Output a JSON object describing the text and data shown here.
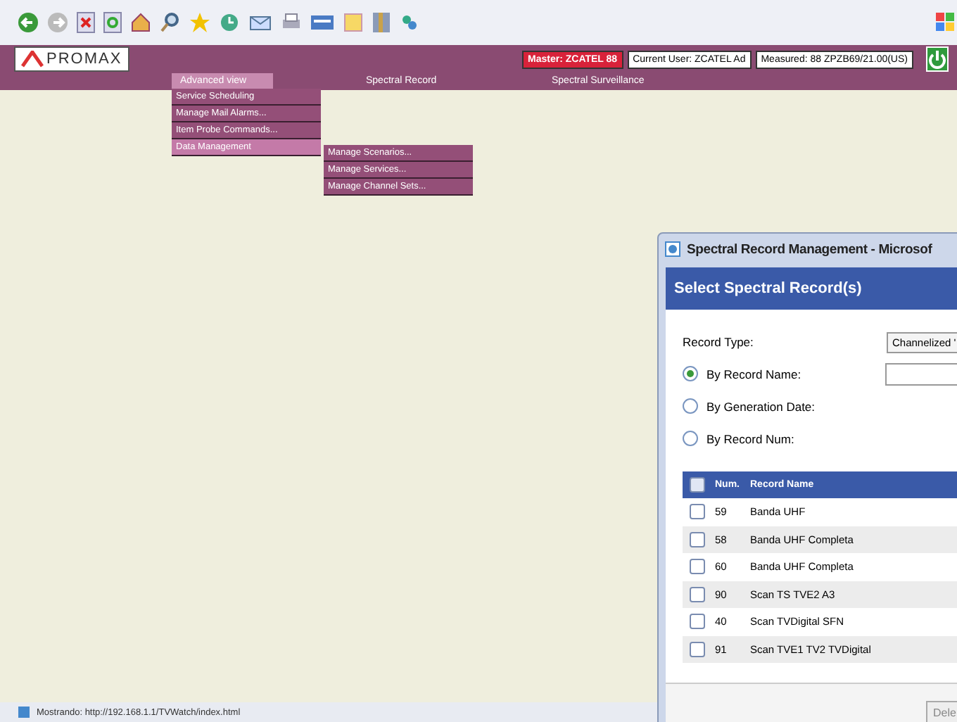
{
  "header": {
    "logo": "PROMAX",
    "badges": [
      {
        "kind": "alert",
        "text": "Master: ZCATEL 88"
      },
      {
        "kind": "field",
        "text": "Current User: ZCATEL Ad"
      },
      {
        "kind": "field",
        "text": "Measured: 88 ZPZB69/21.00(US)"
      }
    ]
  },
  "menu": [
    {
      "label": "Advanced view",
      "selected": true
    },
    {
      "label": "Spectral Record",
      "selected": false
    },
    {
      "label": "Spectral Surveillance",
      "selected": false
    }
  ],
  "dropdown": [
    {
      "label": "Service Scheduling",
      "selected": false
    },
    {
      "label": "Manage Mail Alarms...",
      "selected": false
    },
    {
      "label": "Item Probe Commands...",
      "selected": false
    },
    {
      "label": "Data Management",
      "selected": true
    }
  ],
  "submenu": [
    {
      "label": "Manage Scenarios..."
    },
    {
      "label": "Manage Services..."
    },
    {
      "label": "Manage Channel Sets..."
    }
  ],
  "status_bar": "Mostrando: http://192.168.1.1/TVWatch/index.html",
  "dialog": {
    "title": "Spectral Record Management - Microsof",
    "heading": "Select Spectral Record(s)",
    "record_type_label": "Record Type:",
    "record_type_value": "Channelized '",
    "options": [
      {
        "label": "By Record Name:",
        "selected": true
      },
      {
        "label": "By Generation Date:",
        "selected": false
      },
      {
        "label": "By Record Num:",
        "selected": false
      }
    ],
    "table": {
      "all_checked": false,
      "columns": [
        "Num.",
        "Record Name"
      ],
      "rows": [
        {
          "num": "59",
          "name": "Banda UHF",
          "checked": false
        },
        {
          "num": "58",
          "name": "Banda UHF Completa",
          "checked": false
        },
        {
          "num": "60",
          "name": "Banda UHF Completa",
          "checked": false
        },
        {
          "num": "90",
          "name": "Scan TS TVE2 A3",
          "checked": false
        },
        {
          "num": "40",
          "name": "Scan TVDigital SFN",
          "checked": false
        },
        {
          "num": "91",
          "name": "Scan TVE1 TV2 TVDigital",
          "checked": false
        }
      ]
    },
    "button": "Dele"
  }
}
